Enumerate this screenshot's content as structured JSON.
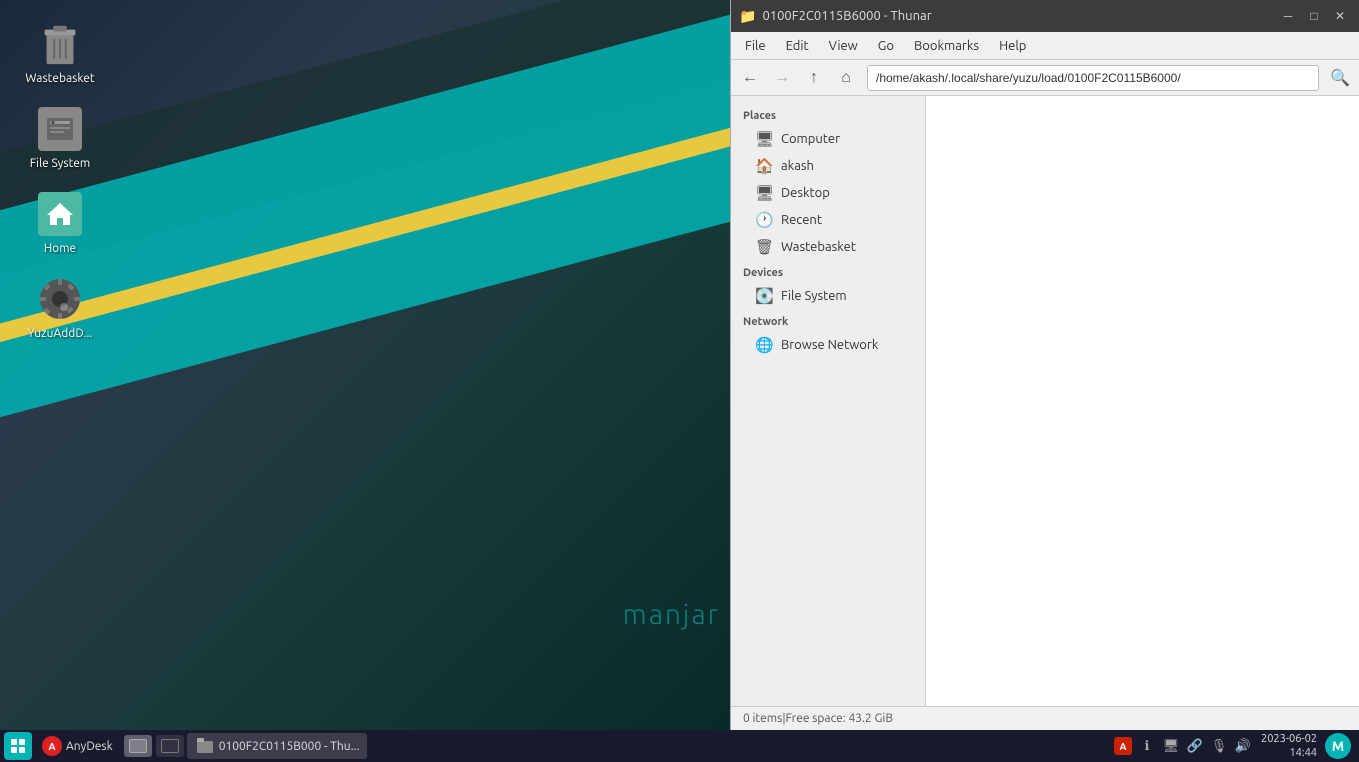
{
  "desktop": {
    "icons": [
      {
        "id": "wastebasket",
        "label": "Wastebasket",
        "type": "trash"
      },
      {
        "id": "filesystem",
        "label": "File System",
        "type": "disk"
      },
      {
        "id": "home",
        "label": "Home",
        "type": "home"
      },
      {
        "id": "yuzu",
        "label": "YuzuAddD...",
        "type": "settings"
      }
    ]
  },
  "titlebar": {
    "title": "0100F2C0115B6000 - Thunar",
    "btn_minimize": "─",
    "btn_restore": "□",
    "btn_close": "✕"
  },
  "menubar": {
    "items": [
      "File",
      "Edit",
      "View",
      "Go",
      "Bookmarks",
      "Help"
    ]
  },
  "toolbar": {
    "back_title": "Back",
    "forward_title": "Forward",
    "up_title": "Up",
    "home_title": "Home",
    "address": "/home/akash/.local/share/yuzu/load/0100F2C0115B6000/",
    "search_title": "Search"
  },
  "sidebar": {
    "sections": [
      {
        "id": "places",
        "label": "Places",
        "items": [
          {
            "id": "computer",
            "label": "Computer",
            "icon": "🖥"
          },
          {
            "id": "akash",
            "label": "akash",
            "icon": "🏠"
          },
          {
            "id": "desktop",
            "label": "Desktop",
            "icon": "🖥"
          },
          {
            "id": "recent",
            "label": "Recent",
            "icon": "🕐"
          },
          {
            "id": "wastebasket",
            "label": "Wastebasket",
            "icon": "🗑"
          }
        ]
      },
      {
        "id": "devices",
        "label": "Devices",
        "items": [
          {
            "id": "filesystem",
            "label": "File System",
            "icon": "💽"
          }
        ]
      },
      {
        "id": "network",
        "label": "Network",
        "items": [
          {
            "id": "browse-network",
            "label": "Browse Network",
            "icon": "🌐"
          }
        ]
      }
    ]
  },
  "statusbar": {
    "items_count": "0 items",
    "separator": " | ",
    "free_space": "Free space: 43.2 GiB"
  },
  "taskbar": {
    "apps": [
      {
        "id": "anydesk",
        "label": "AnyDesk",
        "type": "anydesk"
      },
      {
        "id": "thunar",
        "label": "0100F2C0115B000 - Thu...",
        "type": "folder",
        "active": true
      }
    ],
    "clock": {
      "date": "2023-06-02",
      "time": "14:44"
    },
    "tray_icons": [
      "🔴",
      "ℹ",
      "💻",
      "🔗",
      "🎤",
      "🔊"
    ]
  },
  "manjaro": {
    "text": "manjar"
  }
}
